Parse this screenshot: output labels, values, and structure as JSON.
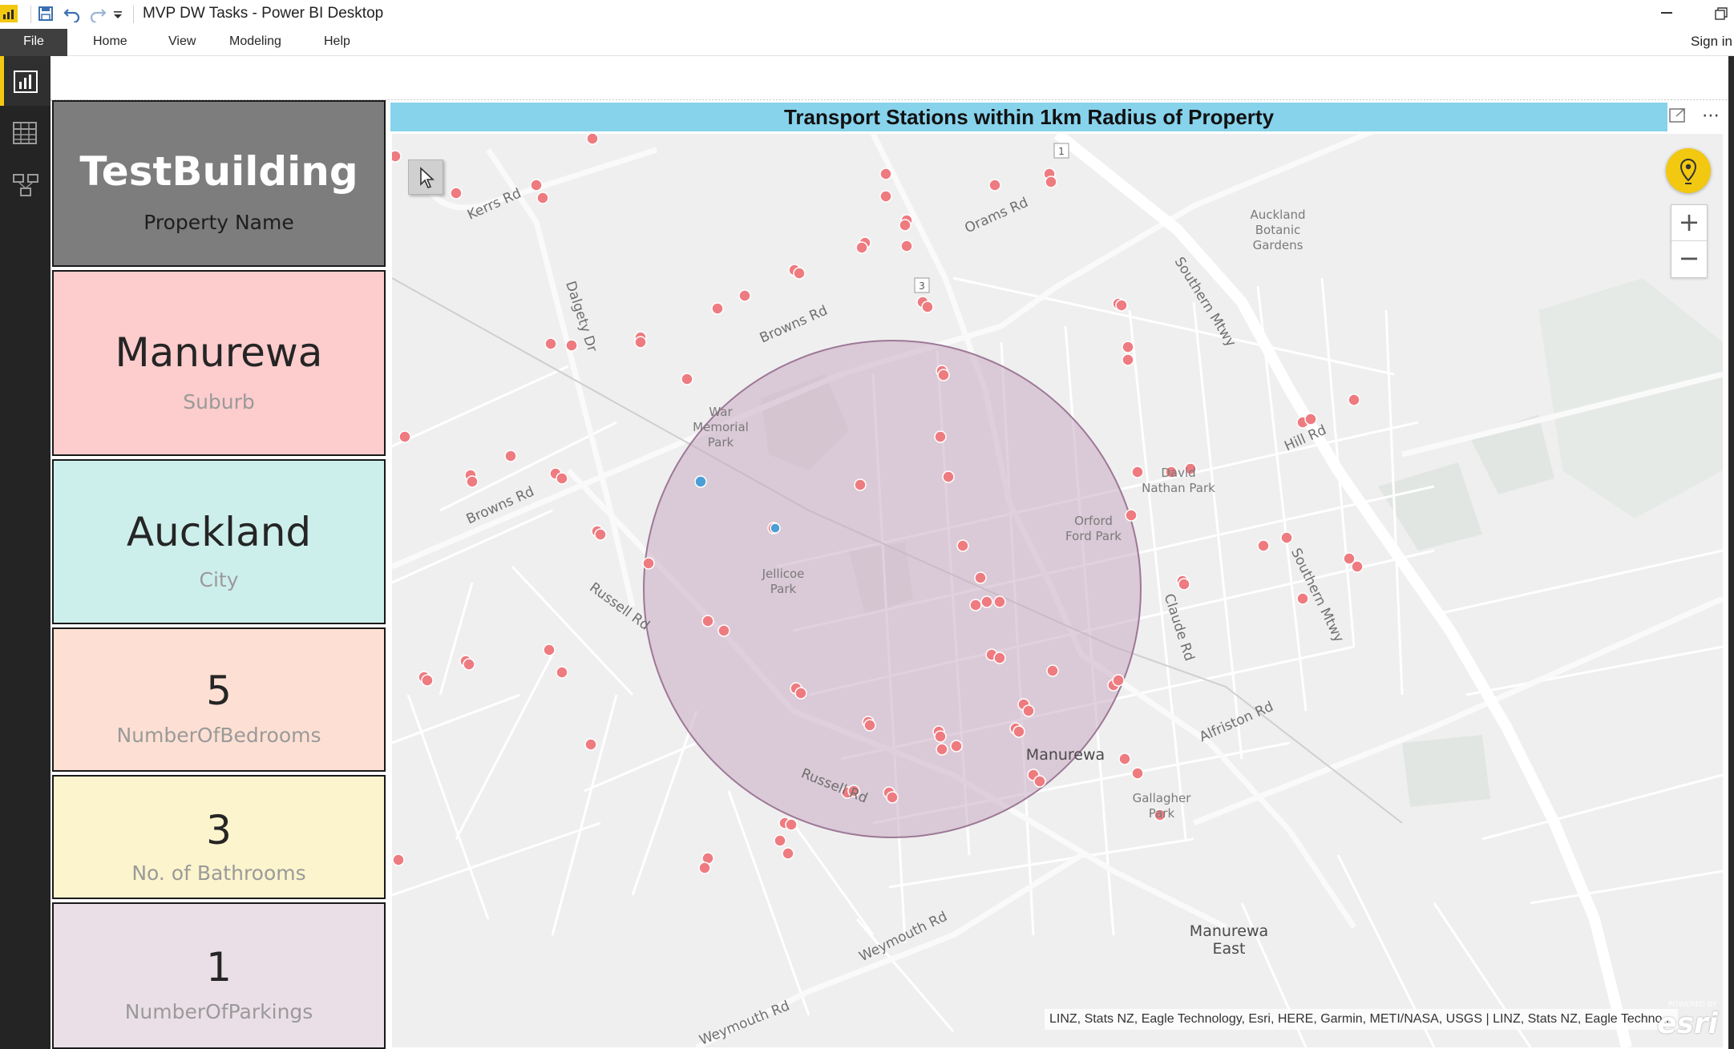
{
  "window": {
    "title": "MVP DW Tasks - Power BI Desktop",
    "icons": [
      "powerbi-logo-icon",
      "save-icon",
      "undo-icon",
      "redo-icon",
      "customize-quick-access-icon",
      "minimize-icon",
      "restore-icon"
    ]
  },
  "ribbon": {
    "tabs": [
      "File",
      "Home",
      "View",
      "Modeling",
      "Help"
    ],
    "sign_in": "Sign in"
  },
  "nav": {
    "items": [
      "report-view-icon",
      "data-view-icon",
      "model-view-icon"
    ],
    "active": "report-view-icon"
  },
  "cards": {
    "property": {
      "value": "TestBuilding",
      "label": "Property Name",
      "color": "#7d7d7d"
    },
    "suburb": {
      "value": "Manurewa",
      "label": "Suburb",
      "color": "#fdcccc"
    },
    "city": {
      "value": "Auckland",
      "label": "City",
      "color": "#cdefec"
    },
    "bedrooms": {
      "value": "5",
      "label": "NumberOfBedrooms",
      "color": "#fde0d3"
    },
    "bathrooms": {
      "value": "3",
      "label": "No. of Bathrooms",
      "color": "#fbf4cd"
    },
    "parkings": {
      "value": "1",
      "label": "NumberOfParkings",
      "color": "#ebdfe7"
    }
  },
  "map": {
    "title": "Transport Stations within 1km Radius of Property",
    "header_color": "#87d3eb",
    "radius_fill": "#c9a9c1",
    "station_color": "#ee7b80",
    "property_color": "#4a9fd5",
    "road_labels": [
      "Kerrs Rd",
      "Dalgety Dr",
      "Browns Rd",
      "Browns Rd",
      "Russell Rd",
      "Russell Rd",
      "Orams Rd",
      "Southern Mtwy",
      "Southern Mtwy",
      "Hill Rd",
      "Claude Rd",
      "Alfriston Rd",
      "Weymouth Rd",
      "Weymouth Rd"
    ],
    "park_labels": [
      "War\nMemorial\nPark",
      "Jellicoe\nPark",
      "Orford\nFord Park",
      "David\nNathan Park",
      "Gallagher\nPark",
      "Auckland\nBotanic\nGardens"
    ],
    "place_labels": [
      "Manurewa",
      "Manurewa\nEast"
    ],
    "road_shields": [
      "1",
      "3"
    ],
    "zoom_in": "+",
    "zoom_out": "−",
    "attribution": "LINZ, Stats NZ, Eagle Technology, Esri, HERE, Garmin, METI/NASA, USGS | LINZ, Stats NZ, Eagle Techno...",
    "esri_powered": "POWERED BY",
    "esri": "esri"
  }
}
